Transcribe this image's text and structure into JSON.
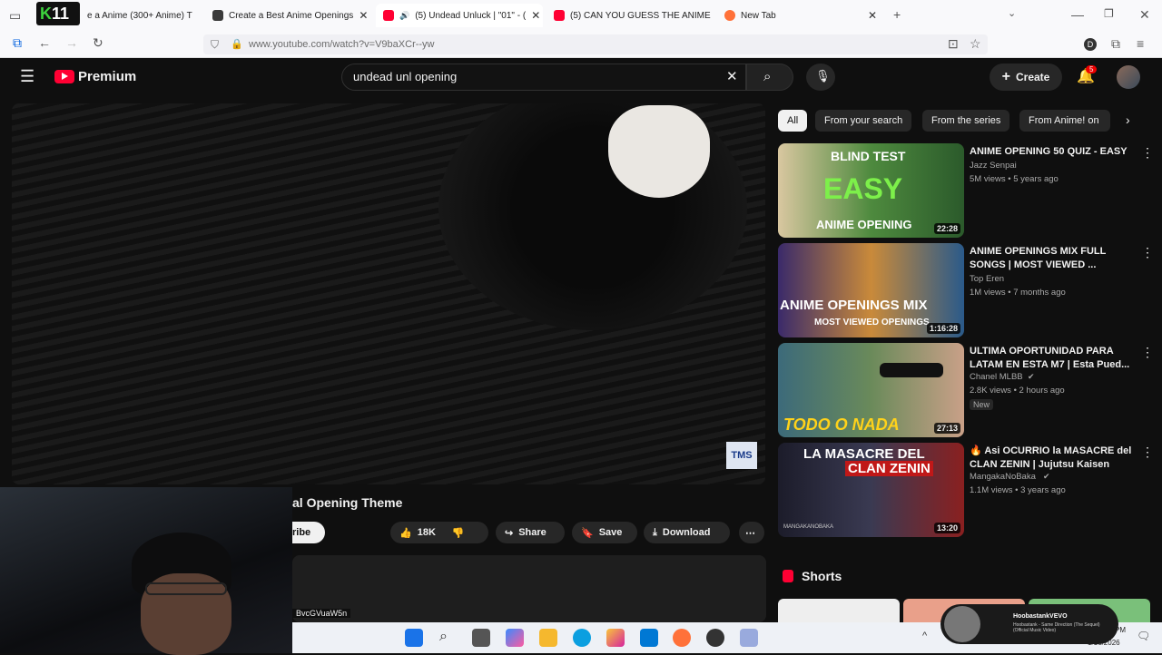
{
  "browser": {
    "tabs": [
      {
        "label": "e a Anime (300+ Anime) T",
        "color": "#111111"
      },
      {
        "label": "Create a Best Anime Openings",
        "color": "#3a3a3a"
      },
      {
        "label": "(5) Undead Unluck | \"01\" - (",
        "color": "#ff0033"
      },
      {
        "label": "(5) CAN YOU GUESS THE ANIME",
        "color": "#ff0033"
      },
      {
        "label": "New Tab",
        "color": "#ff7139"
      }
    ],
    "url": "www.youtube.com/watch?v=V9baXCr--yw",
    "k11_logo": "11"
  },
  "youtube": {
    "logo": "Premium",
    "search_value": "undead unl opening",
    "create_label": "Create",
    "notif_count": "5"
  },
  "chips": [
    "All",
    "From your search",
    "From the series",
    "From Anime! on"
  ],
  "video": {
    "title": "al Opening Theme",
    "subscribe_label": "ribe",
    "likes": "18K",
    "share": "Share",
    "save": "Save",
    "download": "Download",
    "url_hint": "BvcGVuaW5n",
    "watermark": "TMS"
  },
  "recommendations": [
    {
      "title": "ANIME OPENING 50 QUIZ - EASY",
      "channel": "Jazz Senpai",
      "meta": "5M views • 5 years ago",
      "duration": "22:28",
      "thumb_top": "BLIND TEST",
      "thumb_mid": "EASY",
      "thumb_bot": "ANIME OPENING",
      "bg": "#2e6b3a"
    },
    {
      "title": "ANIME OPENINGS MIX FULL SONGS | MOST VIEWED ...",
      "channel": "Top Eren",
      "meta": "1M views • 7 months ago",
      "duration": "1:16:28",
      "thumb_top": "",
      "thumb_mid": "ANIME OPENINGS MIX",
      "thumb_bot": "MOST VIEWED OPENINGS",
      "bg": "#4a3a7a"
    },
    {
      "title": "ULTIMA OPORTUNIDAD PARA LATAM EN ESTA M7 | Esta Pued...",
      "channel": "Chanel MLBB",
      "meta": "2.8K views • 2 hours ago",
      "badge": "New",
      "duration": "27:13",
      "thumb_top": "",
      "thumb_mid": "",
      "thumb_bot": "TODO O NADA",
      "bg": "#3a5a6a"
    },
    {
      "title": "🔥 Asi OCURRIO la MASACRE del CLAN ZENIN | Jujutsu Kaisen",
      "channel": "MangakaNoBaka",
      "meta": "1.1M views • 3 years ago",
      "duration": "13:20",
      "thumb_top": "LA MASACRE DEL",
      "thumb_mid": "CLAN ZENIN",
      "thumb_bot": "MANGAKANOBAKA",
      "bg": "#1c1c2a"
    }
  ],
  "shorts_label": "Shorts",
  "notification_popup": {
    "channel": "HoobastankVEVO",
    "text": "Hoobastank - Same Direction (The Sequel) (Official Music Video)"
  },
  "taskbar": {
    "time": "PM",
    "date": "1/16/2026"
  }
}
